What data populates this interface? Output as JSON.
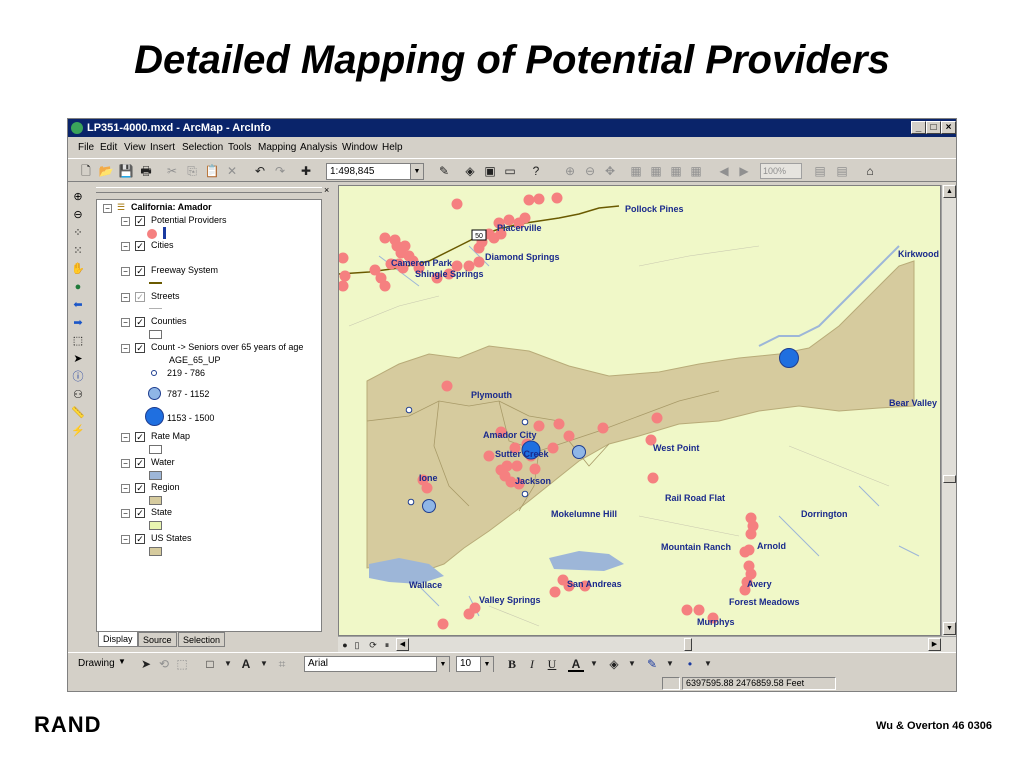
{
  "slide": {
    "title": "Detailed Mapping of Potential Providers",
    "logo": "RAND",
    "footer": "Wu & Overton 46  0306"
  },
  "window": {
    "title": "LP351-4000.mxd - ArcMap - ArcInfo",
    "min_label": "_",
    "max_label": "□",
    "close_label": "×"
  },
  "menu": [
    "File",
    "Edit",
    "View",
    "Insert",
    "Selection",
    "Tools",
    "Mapping",
    "Analysis",
    "Window",
    "Help"
  ],
  "toolbar": {
    "scale": "1:498,845",
    "zoom_percent": "100%"
  },
  "toc": {
    "data_frame": "California: Amador",
    "close_label": "×",
    "layers": [
      {
        "name": "Potential Providers",
        "checked": true
      },
      {
        "name": "Cities",
        "checked": true
      },
      {
        "name": "Freeway System",
        "checked": true
      },
      {
        "name": "Streets",
        "checked": false
      },
      {
        "name": "Counties",
        "checked": true
      },
      {
        "name": "Count -> Seniors over 65 years of age",
        "checked": true
      },
      {
        "name": "Rate Map",
        "checked": true
      },
      {
        "name": "Water",
        "checked": true
      },
      {
        "name": "Region",
        "checked": true
      },
      {
        "name": "State",
        "checked": true
      },
      {
        "name": "US States",
        "checked": true
      }
    ],
    "age_field": "AGE_65_UP",
    "classes": [
      "219 - 786",
      "787 - 1152",
      "1153 - 1500"
    ],
    "tabs": [
      "Display",
      "Source",
      "Selection"
    ]
  },
  "map": {
    "highway_label": "50",
    "places": [
      "Pollock Pines",
      "Placerville",
      "Diamond Springs",
      "Cameron Park",
      "Shingle Springs",
      "Kirkwood",
      "Plymouth",
      "Bear Valley",
      "Amador City",
      "Sutter Creek",
      "West Point",
      "Ione",
      "Jackson",
      "Rail Road Flat",
      "Mokelumne Hill",
      "Dorrington",
      "Mountain Ranch",
      "Arnold",
      "Avery",
      "Forest Meadows",
      "San Andreas",
      "Valley Springs",
      "Wallace",
      "Murphys"
    ]
  },
  "drawing": {
    "label": "Drawing",
    "font": "Arial",
    "size": "10",
    "bold": "B",
    "italic": "I",
    "underline": "U",
    "text_color_label": "A"
  },
  "status": {
    "coordinates": "6397595.88  2476859.58 Feet"
  },
  "colors": {
    "background": "#f0f8c8",
    "county": "#d6cb9e",
    "water": "#9db6d8",
    "provider": "#f58080",
    "senior_circle": "#1f6fe0",
    "label": "#1a2a8c"
  }
}
